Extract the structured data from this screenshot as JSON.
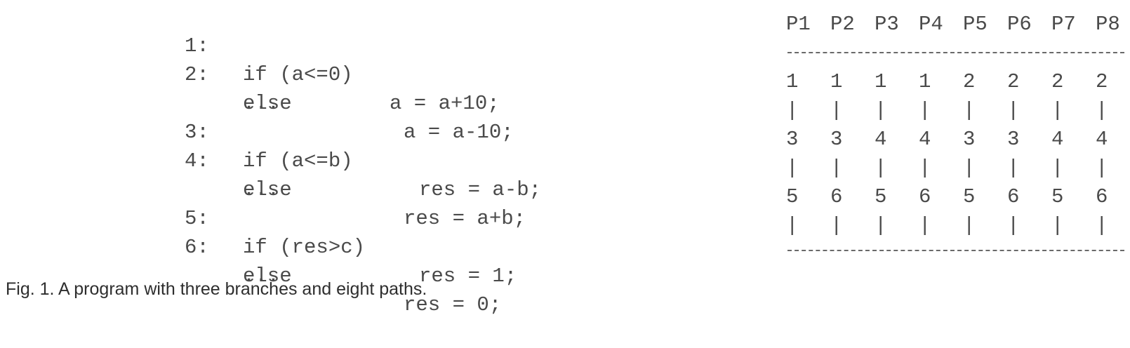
{
  "code": [
    {
      "num": "1:",
      "kw": "if (a<=0)",
      "stmt": "a = a+10;",
      "stmt_col": 555
    },
    {
      "num": "2:",
      "kw": "else",
      "stmt": "a = a-10;",
      "stmt_col": 575
    },
    {
      "num": "",
      "kw": "...",
      "stmt": "",
      "stmt_col": 0
    },
    {
      "num": "3:",
      "kw": "if (a<=b)",
      "stmt": "res = a-b;",
      "stmt_col": 597
    },
    {
      "num": "4:",
      "kw": "else",
      "stmt": "res = a+b;",
      "stmt_col": 575
    },
    {
      "num": "",
      "kw": "...",
      "stmt": "",
      "stmt_col": 0
    },
    {
      "num": "5:",
      "kw": "if (res>c)",
      "stmt": "res = 1;",
      "stmt_col": 597
    },
    {
      "num": "6:",
      "kw": "else",
      "stmt": "res = 0;",
      "stmt_col": 575
    },
    {
      "num": "",
      "kw": "...",
      "stmt": "",
      "stmt_col": 0
    }
  ],
  "paths_table": {
    "headers": [
      "P1",
      "P2",
      "P3",
      "P4",
      "P5",
      "P6",
      "P7",
      "P8"
    ],
    "rows": [
      [
        "1",
        "1",
        "1",
        "1",
        "2",
        "2",
        "2",
        "2"
      ],
      [
        "|",
        "|",
        "|",
        "|",
        "|",
        "|",
        "|",
        "|"
      ],
      [
        "3",
        "3",
        "4",
        "4",
        "3",
        "3",
        "4",
        "4"
      ],
      [
        "|",
        "|",
        "|",
        "|",
        "|",
        "|",
        "|",
        "|"
      ],
      [
        "5",
        "6",
        "5",
        "6",
        "5",
        "6",
        "5",
        "6"
      ],
      [
        "|",
        "|",
        "|",
        "|",
        "|",
        "|",
        "|",
        "|"
      ]
    ]
  },
  "caption": "Fig. 1. A program with three branches and eight paths."
}
